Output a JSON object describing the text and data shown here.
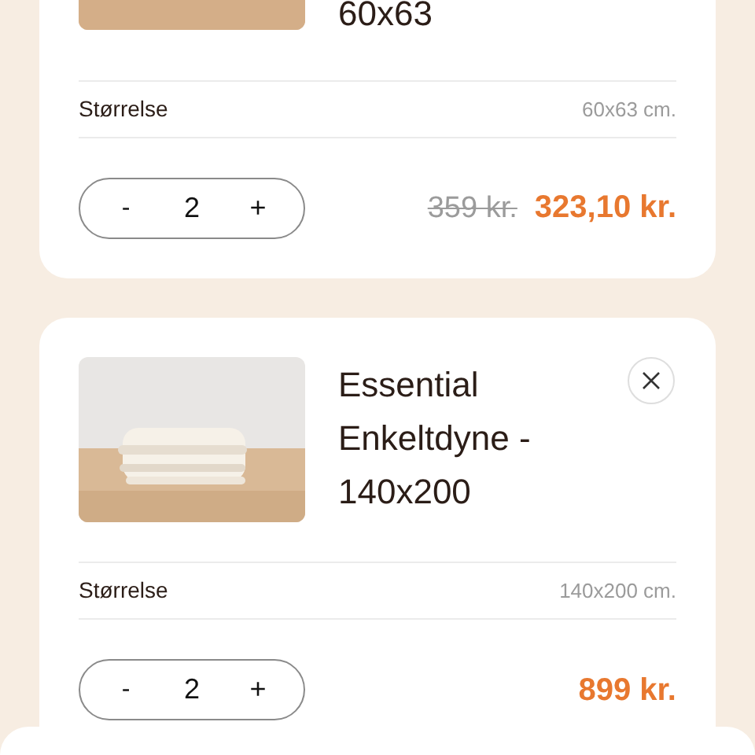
{
  "cart_items": [
    {
      "title": "60x63",
      "size_label": "Størrelse",
      "size_value": "60x63 cm.",
      "quantity": {
        "minus": "-",
        "value": "2",
        "plus": "+"
      },
      "old_price": "359 kr.",
      "price": "323,10 kr."
    },
    {
      "title": "Essential Enkeltdyne - 140x200",
      "size_label": "Størrelse",
      "size_value": "140x200 cm.",
      "quantity": {
        "minus": "-",
        "value": "2",
        "plus": "+"
      },
      "price": "899 kr.",
      "removable": true
    }
  ]
}
